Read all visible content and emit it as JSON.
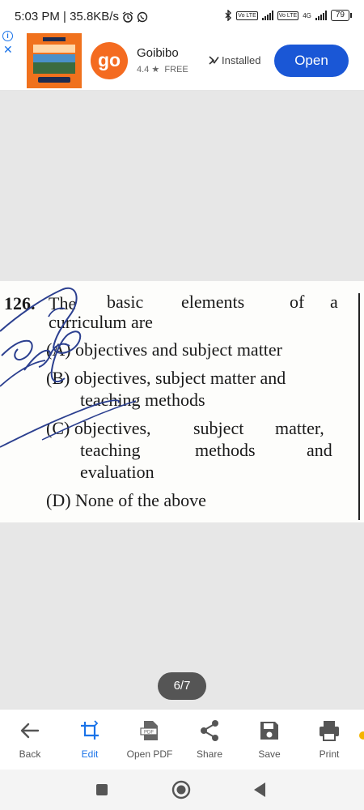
{
  "status_bar": {
    "time_speed": "5:03 PM | 35.8KB/s",
    "volte_label": "Vo LTE",
    "network_label": "4G",
    "battery": "79"
  },
  "ad": {
    "app_name": "Goibibo",
    "icon_text": "go",
    "rating": "4.4 ★",
    "price": "FREE",
    "installed_label": "Installed",
    "open_label": "Open",
    "brand_color": "#f46b20",
    "button_color": "#1a57d6"
  },
  "question": {
    "number": "126.",
    "stem_line1_words": [
      "The",
      "basic",
      "elements",
      "of",
      "a"
    ],
    "stem_line2": "curriculum are",
    "option_a": "(A) objectives and subject matter",
    "option_b_line1": "(B) objectives, subject matter and",
    "option_b_line2": "teaching methods",
    "option_c_line1_words": [
      "(C) objectives,",
      "subject",
      "matter,"
    ],
    "option_c_line2_words": [
      "teaching",
      "methods",
      "and"
    ],
    "option_c_line3": "evaluation",
    "option_d": "(D) None of the above"
  },
  "page_indicator": "6/7",
  "toolbar": {
    "items": [
      {
        "label": "Back",
        "icon": "back-arrow-icon"
      },
      {
        "label": "Edit",
        "icon": "crop-icon"
      },
      {
        "label": "Open PDF",
        "icon": "pdf-icon"
      },
      {
        "label": "Share",
        "icon": "share-icon"
      },
      {
        "label": "Save",
        "icon": "save-icon"
      },
      {
        "label": "Print",
        "icon": "print-icon"
      }
    ],
    "accent_color": "#1a73e8"
  }
}
